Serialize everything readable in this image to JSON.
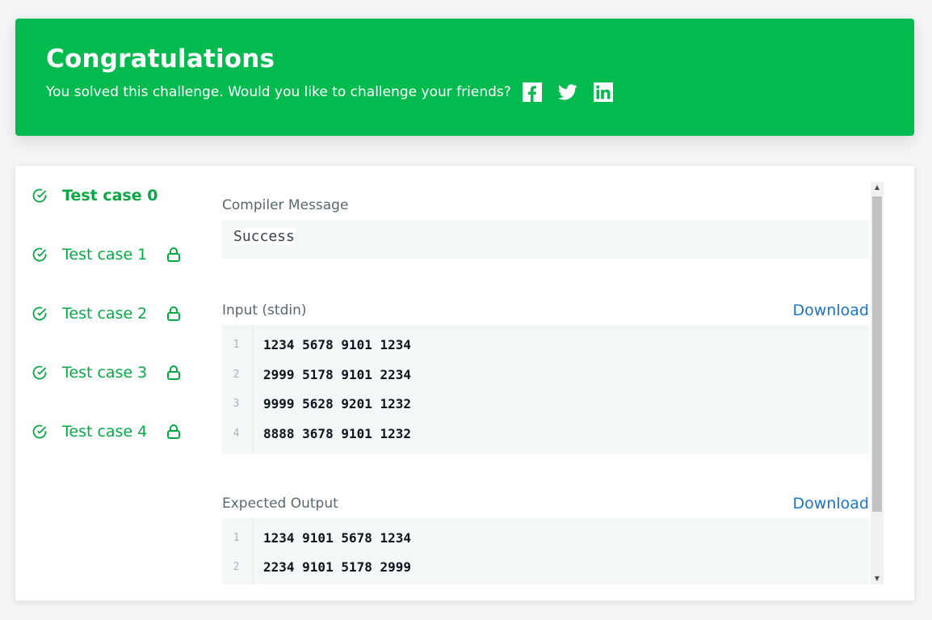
{
  "banner": {
    "title": "Congratulations",
    "subtitle": "You solved this challenge. Would you like to challenge your friends?",
    "social_icons": [
      "facebook-icon",
      "twitter-icon",
      "linkedin-icon"
    ],
    "color": "#02bb4f"
  },
  "test_cases": [
    {
      "label": "Test case 0",
      "active": true,
      "locked": false
    },
    {
      "label": "Test case 1",
      "active": false,
      "locked": true
    },
    {
      "label": "Test case 2",
      "active": false,
      "locked": true
    },
    {
      "label": "Test case 3",
      "active": false,
      "locked": true
    },
    {
      "label": "Test case 4",
      "active": false,
      "locked": true
    }
  ],
  "compiler": {
    "title": "Compiler Message",
    "message": "Success"
  },
  "input": {
    "title": "Input (stdin)",
    "download": "Download",
    "line_numbers": [
      "1",
      "2",
      "3",
      "4"
    ],
    "lines": [
      "1234 5678 9101 1234",
      "2999 5178 9101 2234",
      "9999 5628 9201 1232",
      "8888 3678 9101 1232"
    ]
  },
  "expected": {
    "title": "Expected Output",
    "download": "Download",
    "line_numbers": [
      "1",
      "2"
    ],
    "lines": [
      "1234 9101 5678 1234",
      "2234 9101 5178 2999"
    ]
  },
  "accent": "#08a845",
  "link_color": "#1b74c6"
}
